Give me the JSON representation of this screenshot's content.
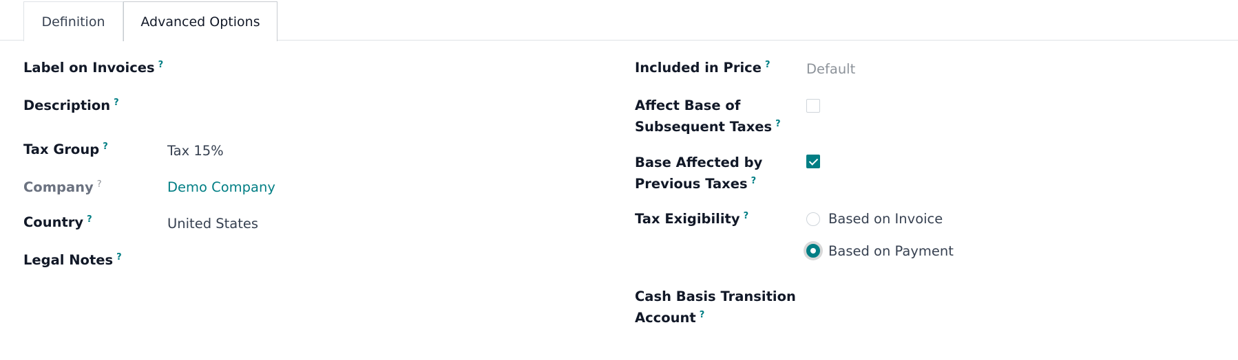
{
  "tabs": [
    {
      "label": "Definition",
      "active": false
    },
    {
      "label": "Advanced Options",
      "active": true
    }
  ],
  "left_fields": {
    "label_on_invoices": {
      "label": "Label on Invoices",
      "help": "?",
      "value": ""
    },
    "description": {
      "label": "Description",
      "help": "?",
      "value": ""
    },
    "tax_group": {
      "label": "Tax Group",
      "help": "?",
      "value": "Tax 15%"
    },
    "company": {
      "label": "Company",
      "help": "?",
      "value": "Demo Company"
    },
    "country": {
      "label": "Country",
      "help": "?",
      "value": "United States"
    },
    "legal_notes": {
      "label": "Legal Notes",
      "help": "?",
      "value": ""
    }
  },
  "right_fields": {
    "included_in_price": {
      "label": "Included in Price",
      "help": "?",
      "value": "Default"
    },
    "affect_base": {
      "label_line1": "Affect Base of",
      "label_line2": "Subsequent Taxes",
      "help": "?",
      "checked": false
    },
    "base_affected": {
      "label_line1": "Base Affected by",
      "label_line2": "Previous Taxes",
      "help": "?",
      "checked": true
    },
    "tax_exigibility": {
      "label": "Tax Exigibility",
      "help": "?",
      "options": [
        {
          "label": "Based on Invoice",
          "selected": false
        },
        {
          "label": "Based on Payment",
          "selected": true
        }
      ]
    },
    "cash_basis": {
      "label_line1": "Cash Basis Transition",
      "label_line2": "Account",
      "help": "?",
      "value": ""
    }
  },
  "colors": {
    "accent": "#017e84",
    "text": "#111827",
    "muted": "#6b7280"
  }
}
